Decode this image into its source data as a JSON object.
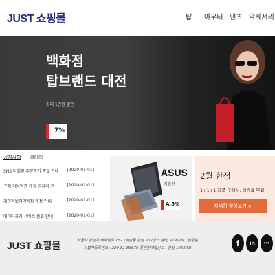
{
  "header": {
    "logo": "JUST 쇼핑몰",
    "nav": [
      "탑",
      "아우터",
      "팬츠",
      "악세서리"
    ]
  },
  "hero": {
    "title_line1": "백화점",
    "title_line2": "탑브랜드 대전",
    "subtitle": "최대 1만원 할인",
    "discount": "7%"
  },
  "notice": {
    "tabs": [
      "공지사항",
      "갤러리"
    ],
    "items": [
      {
        "title": "SNS 비회원 주문하기 종료 안내",
        "date": "[2020-01-01]"
      },
      {
        "title": "구매 이용약관 개정 공지의 건",
        "date": "[2020-01-01]"
      },
      {
        "title": "개인정보처리방침 개정 안내",
        "date": "[2020-01-01]"
      },
      {
        "title": "데이터프리 서비스 종료 안내",
        "date": "[2020-01-01]"
      }
    ]
  },
  "asus_banner": {
    "brand": "ASUS",
    "subtitle": "기획전",
    "discount": "A.5%"
  },
  "promo": {
    "title": "2월 한정",
    "subtitle": "1+1+1 제품 구매시, 배송료 무료",
    "button": "자세히 알아보기 >"
  },
  "footer": {
    "logo": "JUST 쇼핑몰",
    "address": "서울시 강남구 테헤란로 152 (역삼동 강남 파이낸스 센터) 대표이사 : 변광윤",
    "business": "사업자등록번호 : 220-81-83676 통신판매업신고 : 강남 10630호",
    "social": [
      {
        "icon": "facebook-icon",
        "glyph": "f"
      },
      {
        "icon": "linkedin-icon",
        "glyph": "in"
      },
      {
        "icon": "chat-icon",
        "glyph": "•••"
      }
    ]
  },
  "colors": {
    "brand": "#1f2a7a",
    "accent_red": "#d82a2a",
    "promo_bg": "#fde9df",
    "promo_button": "#e36a3a"
  }
}
